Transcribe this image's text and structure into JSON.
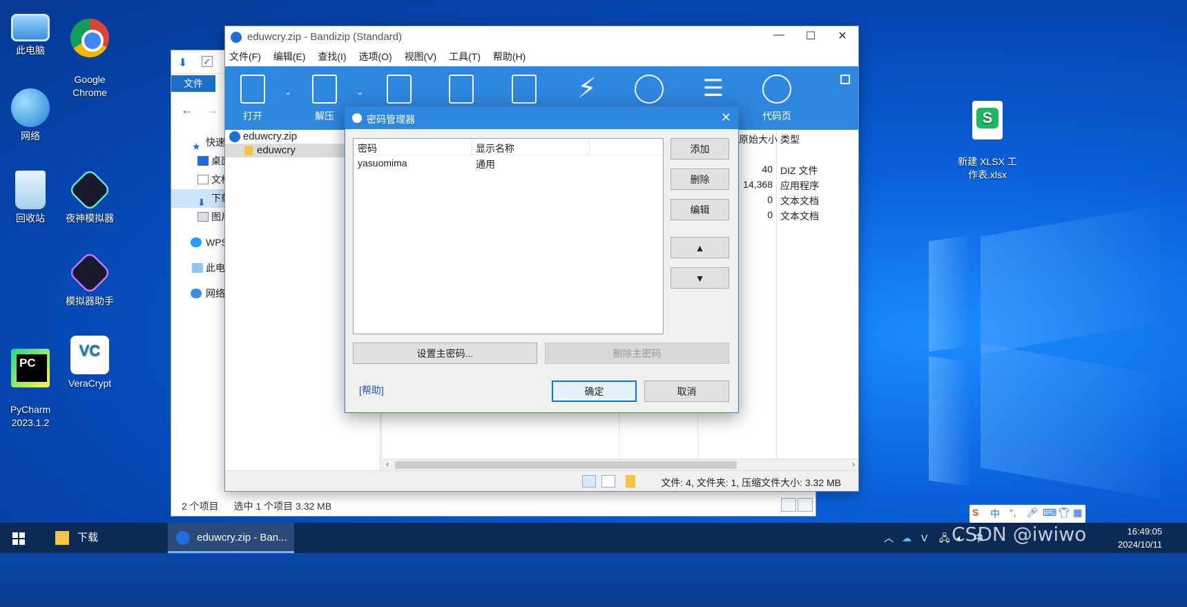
{
  "desktop": {
    "icons": [
      {
        "label": "此电脑",
        "icon": "computer-icon"
      },
      {
        "label": "Google\nChrome",
        "icon": "chrome-icon"
      },
      {
        "label": "网络",
        "icon": "network-icon"
      },
      {
        "label": "回收站",
        "icon": "recycle-bin-icon"
      },
      {
        "label": "夜神模拟器",
        "icon": "nox-icon"
      },
      {
        "label": "模拟器助手",
        "icon": "nox-helper-icon"
      },
      {
        "label": "PyCharm\n2023.1.2",
        "icon": "pycharm-icon"
      },
      {
        "label": "VeraCrypt",
        "icon": "veracrypt-icon"
      },
      {
        "label": "新建 XLSX 工\n作表.xlsx",
        "icon": "xlsx-file-icon"
      }
    ]
  },
  "explorer": {
    "ribbon_tab": "文件",
    "tree": [
      "快速",
      "桌面",
      "文档",
      "下载",
      "图片",
      "WPS",
      "此电",
      "网络"
    ],
    "status_items": "2 个项目",
    "status_selected": "选中 1 个项目  3.32 MB"
  },
  "bandizip": {
    "title": "eduwcry.zip - Bandizip (Standard)",
    "menu": [
      "文件(F)",
      "编辑(E)",
      "查找(I)",
      "选项(O)",
      "视图(V)",
      "工具(T)",
      "帮助(H)"
    ],
    "toolbar": {
      "open": "打开",
      "extract": "解压",
      "codepage": "代码页"
    },
    "tree": {
      "archive": "eduwcry.zip",
      "folder": "eduwcry"
    },
    "columns": {
      "original_size": "原始大小",
      "type": "类型"
    },
    "files": [
      {
        "size": "40",
        "type": "DIZ 文件"
      },
      {
        "size": "14,368",
        "type": "应用程序"
      },
      {
        "size": "0",
        "type": "文本文档"
      },
      {
        "size": "0",
        "type": "文本文档"
      }
    ],
    "status": "文件: 4, 文件夹: 1, 压缩文件大小: 3.32 MB"
  },
  "dialog": {
    "title": "密码管理器",
    "columns": {
      "password": "密码",
      "display_name": "显示名称"
    },
    "rows": [
      {
        "password": "yasuomima",
        "display_name": "通用"
      }
    ],
    "buttons": {
      "add": "添加",
      "delete": "删除",
      "edit": "编辑",
      "up": "▲",
      "down": "▼",
      "set_master": "设置主密码...",
      "delete_master": "删除主密码",
      "ok": "确定",
      "cancel": "取消"
    },
    "help": "[帮助]"
  },
  "taskbar": {
    "apps": [
      {
        "label": "下载",
        "active": false
      },
      {
        "label": "eduwcry.zip - Ban...",
        "active": true
      }
    ],
    "ime": "中",
    "time": "16:49:05",
    "date": "2024/10/11"
  },
  "watermark": "CSDN @iwiwo"
}
